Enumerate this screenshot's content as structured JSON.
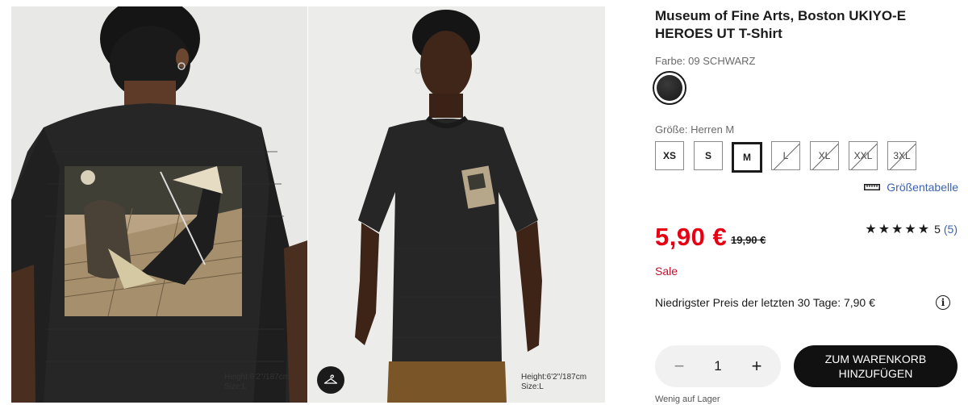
{
  "gallery": {
    "back_caption_line1": "Height:6'2\"/187cm",
    "back_caption_line2": "Size:L",
    "front_caption_line1": "Height:6'2\"/187cm",
    "front_caption_line2": "Size:L",
    "hanger_icon": "hanger-icon"
  },
  "product": {
    "title": "Museum of Fine Arts, Boston UKIYO-E HEROES UT T-Shirt",
    "color_label": "Farbe: 09 SCHWARZ",
    "size_label": "Größe: Herren M",
    "sizes": [
      {
        "label": "XS",
        "state": "available"
      },
      {
        "label": "S",
        "state": "available"
      },
      {
        "label": "M",
        "state": "selected"
      },
      {
        "label": "L",
        "state": "unavailable"
      },
      {
        "label": "XL",
        "state": "unavailable"
      },
      {
        "label": "XXL",
        "state": "unavailable"
      },
      {
        "label": "3XL",
        "state": "unavailable"
      }
    ],
    "size_chart_label": "Größentabelle",
    "price": "5,90 €",
    "old_price": "19,90 €",
    "stars": "★★★★★",
    "rating_value": "5",
    "rating_count": "(5)",
    "sale_label": "Sale",
    "lowest_price": "Niedrigster Preis der letzten 30 Tage: 7,90 €",
    "info_icon": "i",
    "quantity": "1",
    "minus": "−",
    "plus": "+",
    "cart_line1": "ZUM WARENKORB",
    "cart_line2": "HINZUFÜGEN",
    "stock": "Wenig auf Lager"
  },
  "colors": {
    "price_red": "#e60012",
    "link_blue": "#3d63b0",
    "sale_red": "#c4102b",
    "button_black": "#111111"
  }
}
